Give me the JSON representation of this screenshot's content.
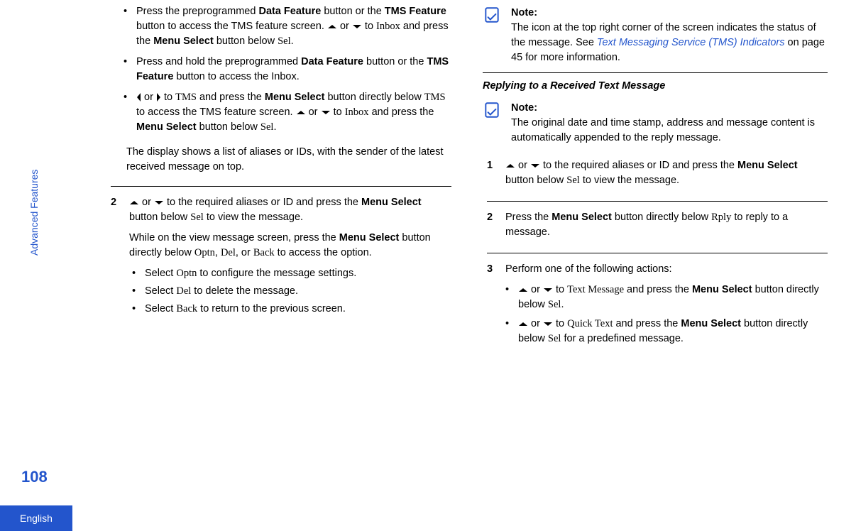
{
  "sidebar": {
    "section_label": "Advanced Features",
    "page_number": "108",
    "language": "English"
  },
  "left_col": {
    "bullets": {
      "b1_a": "Press the preprogrammed ",
      "b1_b": "Data Feature",
      "b1_c": " button or the ",
      "b1_d": "TMS Feature",
      "b1_e": " button to access the TMS feature screen. ",
      "b1_f": " or ",
      "b1_g": " to ",
      "b1_h": "Inbox",
      "b1_i": " and press the ",
      "b1_j": "Menu Select",
      "b1_k": " button below ",
      "b1_l": "Sel",
      "b1_m": ".",
      "b2_a": "Press and hold the preprogrammed ",
      "b2_b": "Data Feature",
      "b2_c": " button or the ",
      "b2_d": "TMS Feature",
      "b2_e": " button to access the Inbox.",
      "b3_a": " or ",
      "b3_b": " to ",
      "b3_c": "TMS",
      "b3_d": " and press the ",
      "b3_e": "Menu Select",
      "b3_f": " button directly below ",
      "b3_g": "TMS",
      "b3_h": " to access the TMS feature screen. ",
      "b3_i": " or ",
      "b3_j": " to ",
      "b3_k": "Inbox",
      "b3_l": " and press the ",
      "b3_m": "Menu Select",
      "b3_n": " button below ",
      "b3_o": "Sel",
      "b3_p": "."
    },
    "result": "The display shows a list of aliases or IDs, with the sender of the latest received message on top.",
    "step2": {
      "num": "2",
      "p1_a": " or ",
      "p1_b": " to the required aliases or ID and press the ",
      "p1_c": "Menu Select",
      "p1_d": " button below ",
      "p1_e": "Sel",
      "p1_f": " to view the message.",
      "p2_a": "While on the view message screen, press the ",
      "p2_b": "Menu Select",
      "p2_c": " button directly below ",
      "p2_d": "Optn",
      "p2_e": ", ",
      "p2_f": "Del",
      "p2_g": ", or ",
      "p2_h": "Back",
      "p2_i": " to access the option.",
      "sb1_a": "Select ",
      "sb1_b": "Optn",
      "sb1_c": " to configure the message settings.",
      "sb2_a": "Select ",
      "sb2_b": "Del",
      "sb2_c": " to delete the message.",
      "sb3_a": "Select ",
      "sb3_b": "Back",
      "sb3_c": " to return to the previous screen."
    }
  },
  "right_col": {
    "note1": {
      "title": "Note:",
      "t1": "The icon at the top right corner of the screen indicates the status of the message. See ",
      "link": "Text Messaging Service (TMS) Indicators",
      "t2": " on page 45 for more information."
    },
    "heading": "Replying to a Received Text Message",
    "note2": {
      "title": "Note:",
      "text": "The original date and time stamp, address and message content is automatically appended to the reply message."
    },
    "step1": {
      "num": "1",
      "a": " or ",
      "b": " to the required aliases or ID and press the ",
      "c": "Menu Select",
      "d": " button below ",
      "e": "Sel",
      "f": " to view the message."
    },
    "step2": {
      "num": "2",
      "a": "Press the ",
      "b": "Menu Select",
      "c": " button directly below ",
      "d": "Rply",
      "e": " to reply to a message."
    },
    "step3": {
      "num": "3",
      "intro": "Perform one of the following actions:",
      "b1_a": " or ",
      "b1_b": " to ",
      "b1_c": "Text Message",
      "b1_d": " and press the ",
      "b1_e": "Menu Select",
      "b1_f": " button directly below ",
      "b1_g": "Sel",
      "b1_h": ".",
      "b2_a": " or ",
      "b2_b": " to ",
      "b2_c": "Quick Text",
      "b2_d": " and press the ",
      "b2_e": "Menu Select",
      "b2_f": " button directly below ",
      "b2_g": "Sel",
      "b2_h": " for a predefined message."
    }
  }
}
